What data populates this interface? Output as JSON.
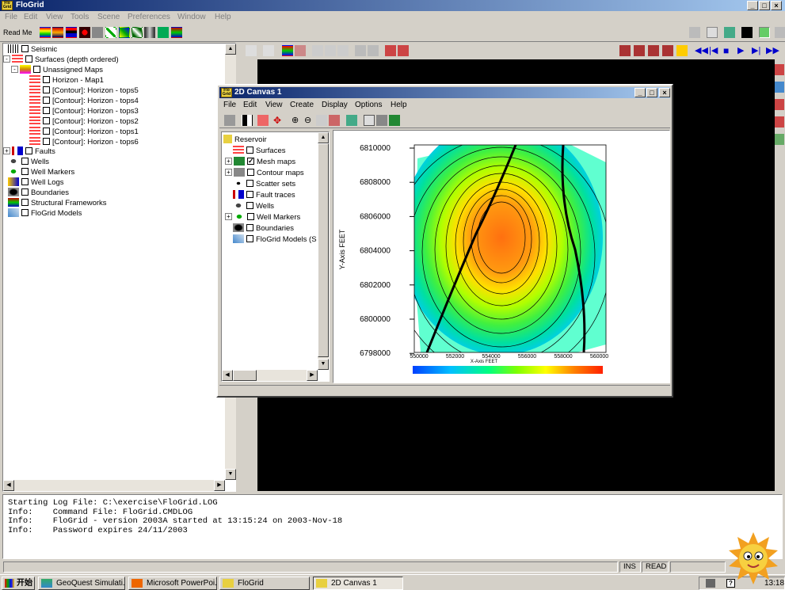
{
  "app": {
    "title": "FloGrid",
    "icon_text": "Flo Grid"
  },
  "menu": [
    "File",
    "Edit",
    "View",
    "Tools",
    "Scene",
    "Preferences",
    "Window",
    "Help"
  ],
  "toolbar": {
    "read_me": "Read Me"
  },
  "tree": {
    "items": [
      {
        "label": "Seismic",
        "indent": 0
      },
      {
        "label": "Surfaces (depth ordered)",
        "indent": 0
      },
      {
        "label": "Unassigned Maps",
        "indent": 1
      },
      {
        "label": "Horizon  - Map1",
        "indent": 2
      },
      {
        "label": "[Contour]: Horizon  - tops5",
        "indent": 2
      },
      {
        "label": "[Contour]: Horizon  - tops4",
        "indent": 2
      },
      {
        "label": "[Contour]: Horizon  - tops3",
        "indent": 2
      },
      {
        "label": "[Contour]: Horizon  - tops2",
        "indent": 2
      },
      {
        "label": "[Contour]: Horizon  - tops1",
        "indent": 2
      },
      {
        "label": "[Contour]: Horizon  - tops6",
        "indent": 2
      },
      {
        "label": "Faults",
        "indent": 0
      },
      {
        "label": "Wells",
        "indent": 0
      },
      {
        "label": "Well Markers",
        "indent": 0
      },
      {
        "label": "Well Logs",
        "indent": 0
      },
      {
        "label": "Boundaries",
        "indent": 0
      },
      {
        "label": "Structural Frameworks",
        "indent": 0
      },
      {
        "label": "FloGrid Models",
        "indent": 0
      }
    ]
  },
  "canvas_window": {
    "title": "2D Canvas 1",
    "menu": [
      "File",
      "Edit",
      "View",
      "Create",
      "Display",
      "Options",
      "Help"
    ],
    "tree": {
      "root": "Reservoir",
      "items": [
        {
          "label": "Surfaces",
          "checked": false
        },
        {
          "label": "Mesh maps",
          "checked": true
        },
        {
          "label": "Contour maps",
          "checked": false
        },
        {
          "label": "Scatter sets",
          "checked": false
        },
        {
          "label": "Fault traces",
          "checked": false
        },
        {
          "label": "Wells",
          "checked": false
        },
        {
          "label": "Well Markers",
          "checked": false
        },
        {
          "label": "Boundaries",
          "checked": false
        },
        {
          "label": "FloGrid Models (S",
          "checked": false
        }
      ]
    },
    "plot": {
      "y_axis_label": "Y-Axis  FEET",
      "x_axis_label": "X-Axis  FEET",
      "y_ticks": [
        "6810000",
        "6808000",
        "6806000",
        "6804000",
        "6802000",
        "6800000",
        "6798000"
      ],
      "x_ticks": [
        "550000",
        "552000",
        "554000",
        "556000",
        "558000",
        "560000"
      ],
      "colorbar_colors": [
        "#0040ff",
        "#00c0ff",
        "#00ff80",
        "#80ff00",
        "#ffff00",
        "#ff8000",
        "#ff2000"
      ]
    }
  },
  "log": {
    "lines": [
      "Starting Log File: C:\\exercise\\FloGrid.LOG",
      "Info:    Command File: FloGrid.CMDLOG",
      "Info:    FloGrid - version 2003A started at 13:15:24 on 2003-Nov-18",
      "Info:    Password expires 24/11/2003"
    ]
  },
  "status": {
    "ins": "INS",
    "read": "READ"
  },
  "taskbar": {
    "start": "开始",
    "tasks": [
      "GeoQuest Simulati...",
      "Microsoft PowerPoi...",
      "FloGrid",
      "2D Canvas 1"
    ],
    "clock": "13:18"
  }
}
